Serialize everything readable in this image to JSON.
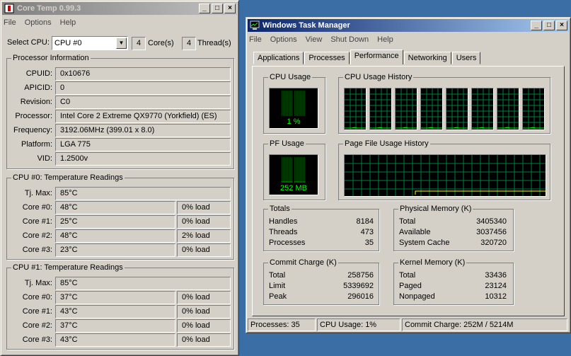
{
  "coretemp": {
    "title": "Core Temp 0.99.3",
    "menu": [
      "File",
      "Options",
      "Help"
    ],
    "select_cpu_label": "Select CPU:",
    "selected_cpu": "CPU #0",
    "cores_value": "4",
    "cores_label": "Core(s)",
    "threads_value": "4",
    "threads_label": "Thread(s)",
    "proc_info_title": "Processor Information",
    "proc": [
      {
        "label": "CPUID:",
        "value": "0x10676"
      },
      {
        "label": "APICID:",
        "value": "0"
      },
      {
        "label": "Revision:",
        "value": "C0"
      },
      {
        "label": "Processor:",
        "value": "Intel Core 2 Extreme QX9770 (Yorkfield) (ES)"
      },
      {
        "label": "Frequency:",
        "value": "3192.06MHz (399.01 x 8.0)"
      },
      {
        "label": "Platform:",
        "value": "LGA 775"
      },
      {
        "label": "VID:",
        "value": "1.2500v"
      }
    ],
    "cpu0": {
      "title": "CPU #0: Temperature Readings",
      "tjmax_label": "Tj. Max:",
      "tjmax": "85°C",
      "cores": [
        {
          "label": "Core #0:",
          "temp": "48°C",
          "load": "0% load"
        },
        {
          "label": "Core #1:",
          "temp": "25°C",
          "load": "0% load"
        },
        {
          "label": "Core #2:",
          "temp": "48°C",
          "load": "2% load"
        },
        {
          "label": "Core #3:",
          "temp": "23°C",
          "load": "0% load"
        }
      ]
    },
    "cpu1": {
      "title": "CPU #1: Temperature Readings",
      "tjmax_label": "Tj. Max:",
      "tjmax": "85°C",
      "cores": [
        {
          "label": "Core #0:",
          "temp": "37°C",
          "load": "0% load"
        },
        {
          "label": "Core #1:",
          "temp": "43°C",
          "load": "0% load"
        },
        {
          "label": "Core #2:",
          "temp": "37°C",
          "load": "0% load"
        },
        {
          "label": "Core #3:",
          "temp": "43°C",
          "load": "0% load"
        }
      ]
    }
  },
  "taskmgr": {
    "title": "Windows Task Manager",
    "menu": [
      "File",
      "Options",
      "View",
      "Shut Down",
      "Help"
    ],
    "tabs": [
      "Applications",
      "Processes",
      "Performance",
      "Networking",
      "Users"
    ],
    "selected_tab": "Performance",
    "cpu_usage_title": "CPU Usage",
    "cpu_usage_value": "1 %",
    "cpu_usage_level": 0.01,
    "cpu_history_title": "CPU Usage History",
    "pf_usage_title": "PF Usage",
    "pf_usage_value": "252 MB",
    "pf_history_title": "Page File Usage History",
    "totals": {
      "title": "Totals",
      "rows": [
        {
          "label": "Handles",
          "value": "8184"
        },
        {
          "label": "Threads",
          "value": "473"
        },
        {
          "label": "Processes",
          "value": "35"
        }
      ]
    },
    "physical": {
      "title": "Physical Memory (K)",
      "rows": [
        {
          "label": "Total",
          "value": "3405340"
        },
        {
          "label": "Available",
          "value": "3037456"
        },
        {
          "label": "System Cache",
          "value": "320720"
        }
      ]
    },
    "commit": {
      "title": "Commit Charge (K)",
      "rows": [
        {
          "label": "Total",
          "value": "258756"
        },
        {
          "label": "Limit",
          "value": "5339692"
        },
        {
          "label": "Peak",
          "value": "296016"
        }
      ]
    },
    "kernel": {
      "title": "Kernel Memory (K)",
      "rows": [
        {
          "label": "Total",
          "value": "33436"
        },
        {
          "label": "Paged",
          "value": "23124"
        },
        {
          "label": "Nonpaged",
          "value": "10312"
        }
      ]
    },
    "status": {
      "processes": "Processes: 35",
      "cpu": "CPU Usage: 1%",
      "commit": "Commit Charge: 252M / 5214M"
    }
  },
  "colors": {
    "graph_green": "#00ff00",
    "grid_green": "#008040",
    "desktop": "#3a6ea5"
  }
}
